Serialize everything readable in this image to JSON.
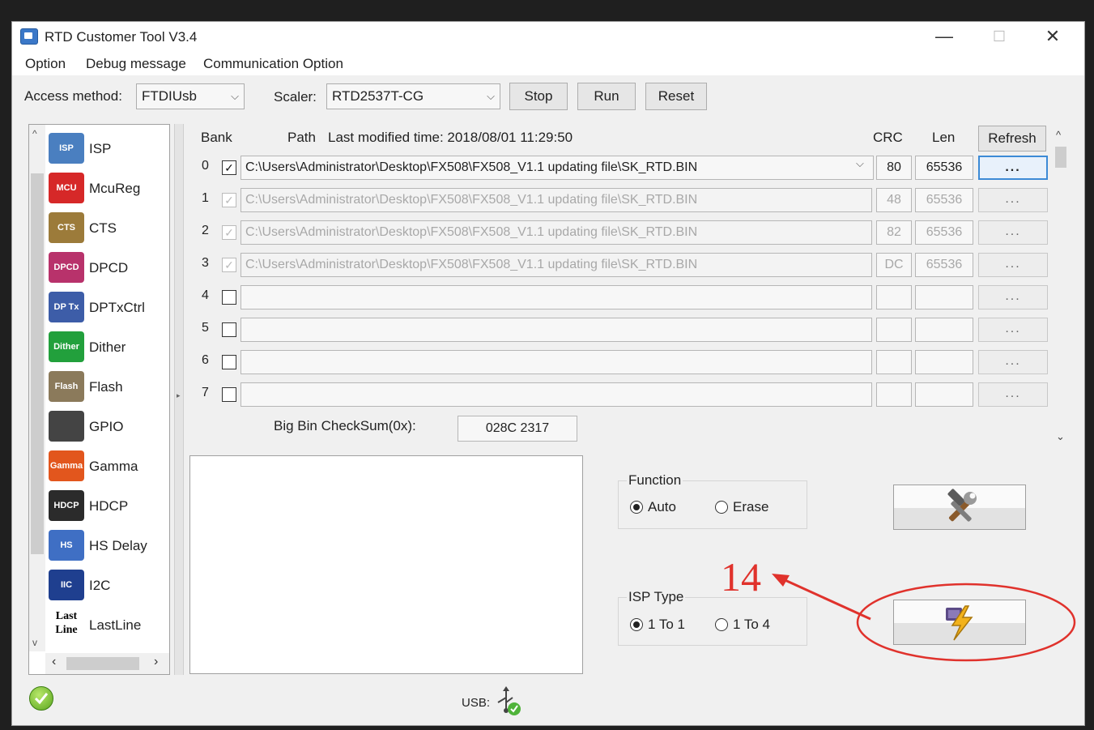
{
  "window": {
    "title": "RTD Customer Tool V3.4",
    "controls": {
      "minimize": "—",
      "maximize": "☐",
      "close": "✕"
    }
  },
  "menu": {
    "items": [
      "Option",
      "Debug message",
      "Communication Option"
    ]
  },
  "toolbar": {
    "access_label": "Access method:",
    "access_value": "FTDIUsb",
    "scaler_label": "Scaler:",
    "scaler_value": "RTD2537T-CG",
    "stop": "Stop",
    "run": "Run",
    "reset": "Reset"
  },
  "sidebar": {
    "items": [
      {
        "label": "ISP",
        "icon": "isp-icon",
        "icon_text": "ISP",
        "color": "#4a7fc0"
      },
      {
        "label": "McuReg",
        "icon": "mcu-icon",
        "icon_text": "MCU",
        "color": "#d62828"
      },
      {
        "label": "CTS",
        "icon": "cts-icon",
        "icon_text": "CTS",
        "color": "#9c7b3a"
      },
      {
        "label": "DPCD",
        "icon": "dpcd-icon",
        "icon_text": "DPCD",
        "color": "#b8326b"
      },
      {
        "label": "DPTxCtrl",
        "icon": "dptx-icon",
        "icon_text": "DP Tx",
        "color": "#3d5da8"
      },
      {
        "label": "Dither",
        "icon": "dither-icon",
        "icon_text": "Dither",
        "color": "#22a03c"
      },
      {
        "label": "Flash",
        "icon": "flash-icon",
        "icon_text": "Flash",
        "color": "#8b7a5b"
      },
      {
        "label": "GPIO",
        "icon": "gpio-icon",
        "icon_text": "",
        "color": "#444444"
      },
      {
        "label": "Gamma",
        "icon": "gamma-icon",
        "icon_text": "Gamma",
        "color": "#e2561d"
      },
      {
        "label": "HDCP",
        "icon": "hdcp-icon",
        "icon_text": "HDCP",
        "color": "#2b2b2b"
      },
      {
        "label": "HS Delay",
        "icon": "hs-delay-icon",
        "icon_text": "HS Delay",
        "color": "#3f6fc4"
      },
      {
        "label": "I2C",
        "icon": "i2c-icon",
        "icon_text": "IIC",
        "color": "#1f3f8f"
      },
      {
        "label": "LastLine",
        "icon": "lastline-icon",
        "icon_text": "Last Line",
        "color": "#ffffff"
      }
    ]
  },
  "banks": {
    "header_bank": "Bank",
    "header_path": "Path",
    "last_modified": "Last modified time: 2018/08/01 11:29:50",
    "header_crc": "CRC",
    "header_len": "Len",
    "refresh": "Refresh",
    "rows": [
      {
        "num": "0",
        "checked": true,
        "enabled": true,
        "path": "C:\\Users\\Administrator\\Desktop\\FX508\\FX508_V1.1 updating file\\SK_RTD.BIN",
        "crc": "80",
        "len": "65536"
      },
      {
        "num": "1",
        "checked": true,
        "enabled": false,
        "path": "C:\\Users\\Administrator\\Desktop\\FX508\\FX508_V1.1 updating file\\SK_RTD.BIN",
        "crc": "48",
        "len": "65536"
      },
      {
        "num": "2",
        "checked": true,
        "enabled": false,
        "path": "C:\\Users\\Administrator\\Desktop\\FX508\\FX508_V1.1 updating file\\SK_RTD.BIN",
        "crc": "82",
        "len": "65536"
      },
      {
        "num": "3",
        "checked": true,
        "enabled": false,
        "path": "C:\\Users\\Administrator\\Desktop\\FX508\\FX508_V1.1 updating file\\SK_RTD.BIN",
        "crc": "DC",
        "len": "65536"
      },
      {
        "num": "4",
        "checked": false,
        "enabled": true,
        "path": "",
        "crc": "",
        "len": ""
      },
      {
        "num": "5",
        "checked": false,
        "enabled": true,
        "path": "",
        "crc": "",
        "len": ""
      },
      {
        "num": "6",
        "checked": false,
        "enabled": true,
        "path": "",
        "crc": "",
        "len": ""
      },
      {
        "num": "7",
        "checked": false,
        "enabled": true,
        "path": "",
        "crc": "",
        "len": ""
      }
    ],
    "browse_label": "...",
    "checksum_label": "Big Bin CheckSum(0x):",
    "checksum_value": "028C 2317"
  },
  "function_group": {
    "title": "Function",
    "auto": "Auto",
    "erase": "Erase",
    "selected": "Auto"
  },
  "isp_type_group": {
    "title": "ISP Type",
    "one_to_one": "1 To 1",
    "one_to_four": "1 To 4",
    "selected": "1 To 1"
  },
  "annotation": {
    "number": "14",
    "color": "#e0322c"
  },
  "status": {
    "usb_label": "USB:"
  }
}
